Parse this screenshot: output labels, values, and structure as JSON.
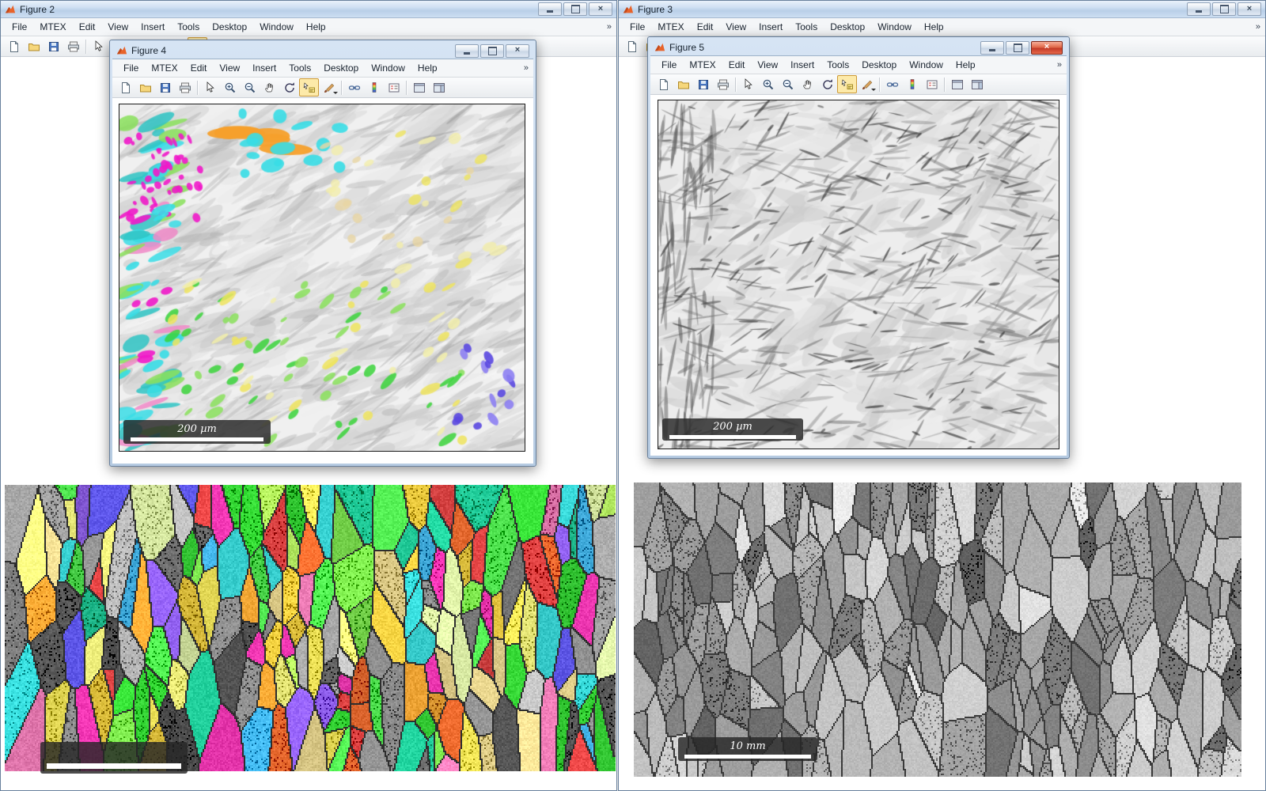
{
  "windows": {
    "figure2": {
      "title": "Figure 2"
    },
    "figure3": {
      "title": "Figure 3"
    },
    "figure4": {
      "title": "Figure 4"
    },
    "figure5": {
      "title": "Figure 5"
    }
  },
  "window_controls": {
    "close_glyph": "×"
  },
  "menu": {
    "items": [
      "File",
      "MTEX",
      "Edit",
      "View",
      "Insert",
      "Tools",
      "Desktop",
      "Window",
      "Help"
    ],
    "overflow_glyph": "»"
  },
  "toolbar": {
    "icons": [
      "new-figure",
      "open-file",
      "save-figure",
      "print-figure",
      "edit-plot",
      "zoom-in",
      "zoom-out",
      "pan",
      "rotate-3d",
      "data-cursor",
      "brush",
      "link-plots",
      "insert-colorbar",
      "insert-legend",
      "hide-plot-tools",
      "show-plot-tools"
    ]
  },
  "scalebars": {
    "figure4_label": "200 µm",
    "figure5_label": "200 µm",
    "figure3_label": "10 mm"
  },
  "maps": {
    "bottom_left": {
      "type": "ebsd-orientation-map",
      "palette": [
        "#35d435",
        "#7ce24e",
        "#b4ec60",
        "#f2e659",
        "#e9c93f",
        "#f0a534",
        "#ee7cb6",
        "#ef36b2",
        "#dd4343",
        "#8d5ee8",
        "#5a53e0",
        "#44b6ea",
        "#38d5d5",
        "#20c997",
        "#8a8a8a",
        "#6f6f6f",
        "#bdbdbd",
        "#545454",
        "#d7e8a2",
        "#ead78f",
        "#e8692e",
        "#f2f27e",
        "#4fe04f",
        "#a0a0a0"
      ]
    },
    "bottom_right": {
      "type": "grain-map-grayscale",
      "palette": [
        "#696969",
        "#787878",
        "#858585",
        "#919191",
        "#9d9d9d",
        "#a9a9a9",
        "#b5b5b5",
        "#c1c1c1",
        "#cdcdcd",
        "#d9d9d9",
        "#8d8d8d",
        "#b0b0b0",
        "#c8c8c8",
        "#a2a2a2"
      ]
    },
    "figure4": {
      "type": "ebsd-map-partial",
      "background": "#f0f0f0",
      "patch_colors": [
        "#39dde6",
        "#2fc4c4",
        "#ef1ac9",
        "#f5a02c",
        "#eee45f",
        "#8ae05c",
        "#3bd43b",
        "#5a48e0",
        "#8d7ff2",
        "#f08ac8",
        "#e9d6a4",
        "#f2eeab"
      ]
    },
    "figure5": {
      "type": "band-contrast-map",
      "background": "#ededed"
    }
  }
}
